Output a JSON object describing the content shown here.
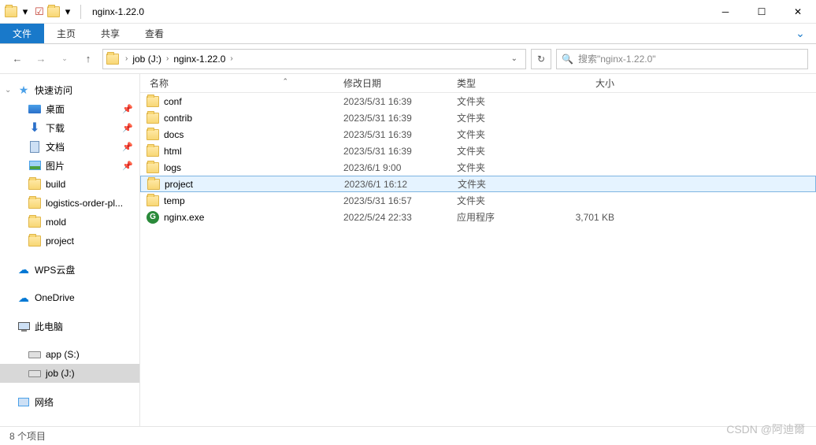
{
  "titlebar": {
    "title": "nginx-1.22.0"
  },
  "ribbon": {
    "file": "文件",
    "tabs": [
      "主页",
      "共享",
      "查看"
    ]
  },
  "breadcrumb": {
    "items": [
      "job (J:)",
      "nginx-1.22.0"
    ]
  },
  "search": {
    "placeholder": "搜索\"nginx-1.22.0\""
  },
  "columns": {
    "name": "名称",
    "date": "修改日期",
    "type": "类型",
    "size": "大小"
  },
  "sidebar": {
    "quick": {
      "label": "快速访问",
      "items": [
        {
          "label": "桌面",
          "icon": "desktop",
          "pinned": true
        },
        {
          "label": "下载",
          "icon": "download",
          "pinned": true
        },
        {
          "label": "文档",
          "icon": "doc",
          "pinned": true
        },
        {
          "label": "图片",
          "icon": "pic",
          "pinned": true
        },
        {
          "label": "build",
          "icon": "folder",
          "pinned": false
        },
        {
          "label": "logistics-order-pl...",
          "icon": "folder",
          "pinned": false
        },
        {
          "label": "mold",
          "icon": "folder",
          "pinned": false
        },
        {
          "label": "project",
          "icon": "folder",
          "pinned": false
        }
      ]
    },
    "wps": "WPS云盘",
    "onedrive": "OneDrive",
    "thispc": {
      "label": "此电脑",
      "drives": [
        {
          "label": "app (S:)"
        },
        {
          "label": "job (J:)",
          "active": true
        }
      ]
    },
    "network": "网络"
  },
  "files": [
    {
      "name": "conf",
      "date": "2023/5/31 16:39",
      "type": "文件夹",
      "size": "",
      "icon": "folder"
    },
    {
      "name": "contrib",
      "date": "2023/5/31 16:39",
      "type": "文件夹",
      "size": "",
      "icon": "folder"
    },
    {
      "name": "docs",
      "date": "2023/5/31 16:39",
      "type": "文件夹",
      "size": "",
      "icon": "folder"
    },
    {
      "name": "html",
      "date": "2023/5/31 16:39",
      "type": "文件夹",
      "size": "",
      "icon": "folder"
    },
    {
      "name": "logs",
      "date": "2023/6/1 9:00",
      "type": "文件夹",
      "size": "",
      "icon": "folder"
    },
    {
      "name": "project",
      "date": "2023/6/1 16:12",
      "type": "文件夹",
      "size": "",
      "icon": "folder",
      "selected": true
    },
    {
      "name": "temp",
      "date": "2023/5/31 16:57",
      "type": "文件夹",
      "size": "",
      "icon": "folder"
    },
    {
      "name": "nginx.exe",
      "date": "2022/5/24 22:33",
      "type": "应用程序",
      "size": "3,701 KB",
      "icon": "exe"
    }
  ],
  "status": "8 个项目",
  "watermark": "CSDN @阿迪爾"
}
